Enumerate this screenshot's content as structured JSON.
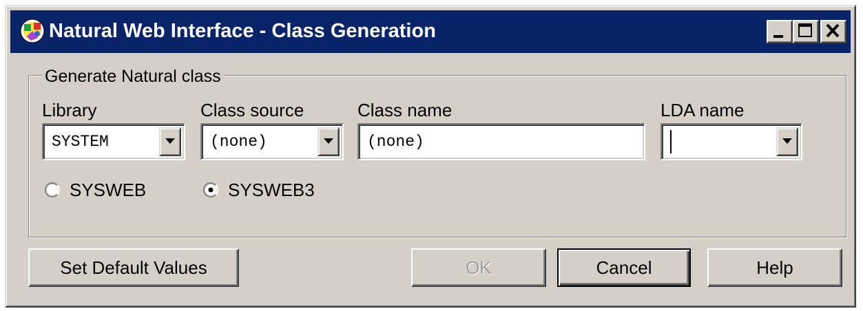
{
  "window": {
    "title": "Natural Web Interface - Class Generation",
    "icon": "natural-app-icon",
    "controls": [
      "minimize-icon",
      "maximize-icon",
      "close-icon"
    ]
  },
  "group": {
    "legend": "Generate Natural class",
    "library": {
      "label": "Library",
      "value": "SYSTEM"
    },
    "class_source": {
      "label": "Class source",
      "value": "(none)"
    },
    "class_name": {
      "label": "Class name",
      "value": "(none)"
    },
    "lda_name": {
      "label": "LDA name",
      "value": ""
    },
    "radios": [
      {
        "label": "SYSWEB",
        "selected": false
      },
      {
        "label": "SYSWEB3",
        "selected": true
      }
    ]
  },
  "buttons": {
    "set_default": "Set Default Values",
    "ok": "OK",
    "cancel": "Cancel",
    "help": "Help"
  },
  "colors": {
    "titlebar": "#0a246a",
    "face": "#d4d0c8",
    "disabled_text": "#a0a0a0"
  }
}
